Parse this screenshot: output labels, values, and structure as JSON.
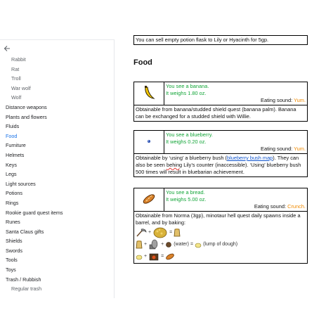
{
  "sidebar": {
    "back_icon": "arrow-left-icon",
    "items": [
      {
        "label": "Rabbit",
        "sub": true
      },
      {
        "label": "Rat",
        "sub": true
      },
      {
        "label": "Troll",
        "sub": true
      },
      {
        "label": "War wolf",
        "sub": true
      },
      {
        "label": "Wolf",
        "sub": true
      },
      {
        "label": "Distance weapons",
        "sub": false
      },
      {
        "label": "Plants and flowers",
        "sub": false
      },
      {
        "label": "Fluids",
        "sub": false
      },
      {
        "label": "Food",
        "sub": false,
        "active": true
      },
      {
        "label": "Furniture",
        "sub": false
      },
      {
        "label": "Helmets",
        "sub": false
      },
      {
        "label": "Keys",
        "sub": false
      },
      {
        "label": "Legs",
        "sub": false
      },
      {
        "label": "Light sources",
        "sub": false
      },
      {
        "label": "Potions",
        "sub": false
      },
      {
        "label": "Rings",
        "sub": false
      },
      {
        "label": "Rookie guard quest items",
        "sub": false
      },
      {
        "label": "Runes",
        "sub": false
      },
      {
        "label": "Santa Claus gifts",
        "sub": false
      },
      {
        "label": "Shields",
        "sub": false
      },
      {
        "label": "Swords",
        "sub": false
      },
      {
        "label": "Tools",
        "sub": false
      },
      {
        "label": "Toys",
        "sub": false
      },
      {
        "label": "Trash / Rubbish",
        "sub": false
      },
      {
        "label": "Regular trash",
        "sub": true
      }
    ]
  },
  "main": {
    "top_note": "You can sell empty potion flask to Lily or Hyacinth for 5gp.",
    "section_title": "Food",
    "items": {
      "banana": {
        "see": "You see a banana.",
        "weight": "It weighs 1.80 oz.",
        "eat_label": "Eating sound: ",
        "eat_sound": "Yum.",
        "desc": "Obtainable from banana/studded shield quest (banana palm). Banana can be exchanged for a studded shield with Willie."
      },
      "blueberry": {
        "see": "You see a blueberry.",
        "weight": "It weighs 0.20 oz.",
        "eat_label": "Eating sound: ",
        "eat_sound": "Yum.",
        "desc_a": "Obtainable by ‘using’ a blueberry bush (",
        "link": "blueberry bush map",
        "desc_b": "). They can also be seen ",
        "wavy": "behing",
        "desc_c": " Lily’s counter (inaccessible). ‘Using’ blueberry bush 500 times will result in bluebarian achievement."
      },
      "bread": {
        "see": "You see a bread.",
        "weight": "It weighs 5.00 oz.",
        "eat_label": "Eating sound: ",
        "eat_sound": "Crunch.",
        "desc": "Obtainable from Norma (3gp), minotaur hell quest daily spawns inside a barrel, and by baking:",
        "plus": "+",
        "eq": "=",
        "water": "(water)",
        "dough": "(lump of dough)"
      }
    }
  },
  "colors": {
    "green": "#13a538",
    "orange": "#f08a00",
    "link": "#1155cc",
    "active": "#1a73e8"
  }
}
